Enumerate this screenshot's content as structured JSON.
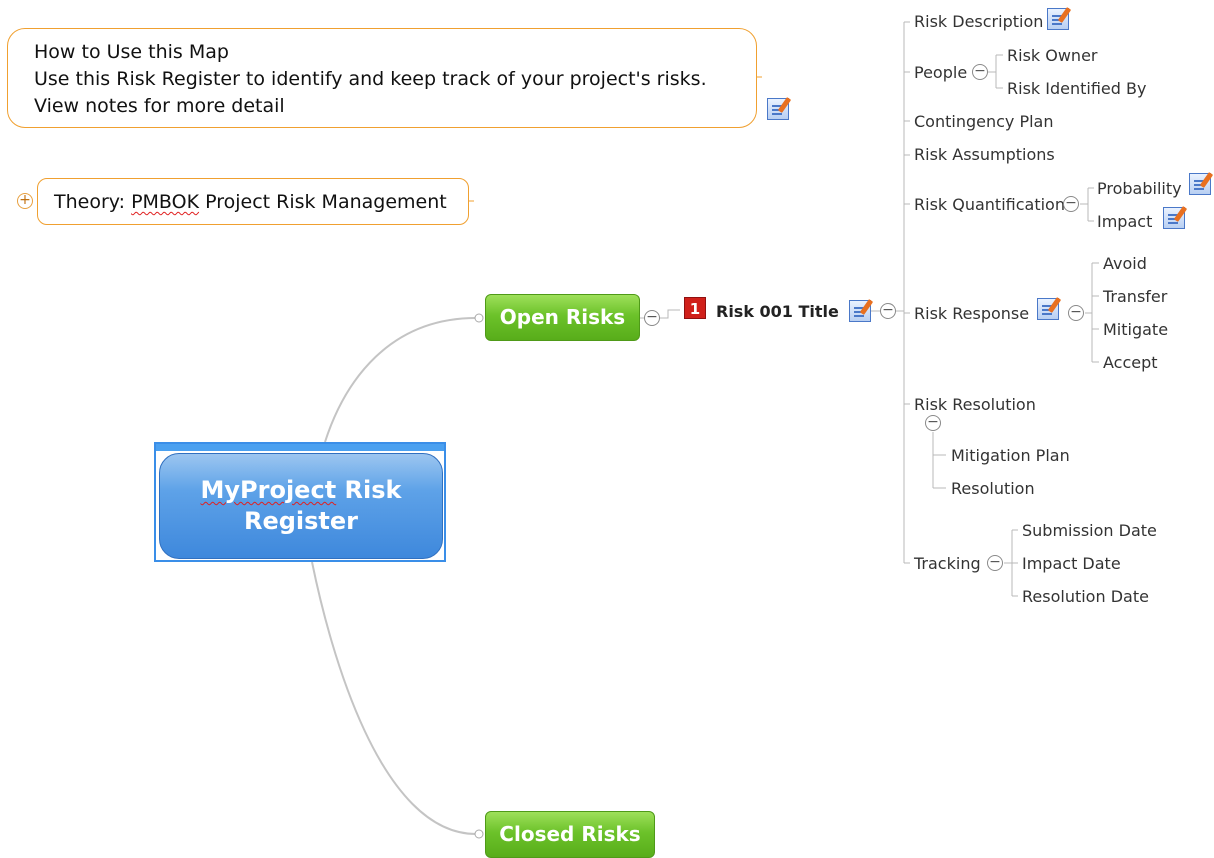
{
  "howto": {
    "line1": "How to Use this Map",
    "line2": "Use this Risk Register to identify and keep track of your project's risks.",
    "line3": "View notes for more detail"
  },
  "theory": {
    "prefix": "Theory: ",
    "pmbok": "PMBOK",
    "suffix": " Project Risk Management"
  },
  "central": {
    "word1": "MyProject",
    "rest": " Risk",
    "line2": "Register"
  },
  "branches": {
    "open": "Open Risks",
    "closed": "Closed Risks"
  },
  "risk": {
    "badge": "1",
    "title": "Risk 001 Title"
  },
  "topics": {
    "description": "Risk Description",
    "people": "People",
    "owner": "Risk Owner",
    "identified_by": "Risk Identified By",
    "contingency": "Contingency Plan",
    "assumptions": "Risk Assumptions",
    "quantification": "Risk Quantification",
    "probability": "Probability",
    "impact": "Impact",
    "response": "Risk Response",
    "avoid": "Avoid",
    "transfer": "Transfer",
    "mitigate": "Mitigate",
    "accept": "Accept",
    "resolution": "Risk Resolution",
    "mitigation_plan": "Mitigation Plan",
    "resolution_child": "Resolution",
    "tracking": "Tracking",
    "submission_date": "Submission Date",
    "impact_date": "Impact Date",
    "resolution_date": "Resolution Date"
  },
  "colors": {
    "central": "#4a90e0",
    "branch_green": "#6cc22a",
    "callout_border": "#f0a030",
    "badge_red": "#d0201a"
  }
}
